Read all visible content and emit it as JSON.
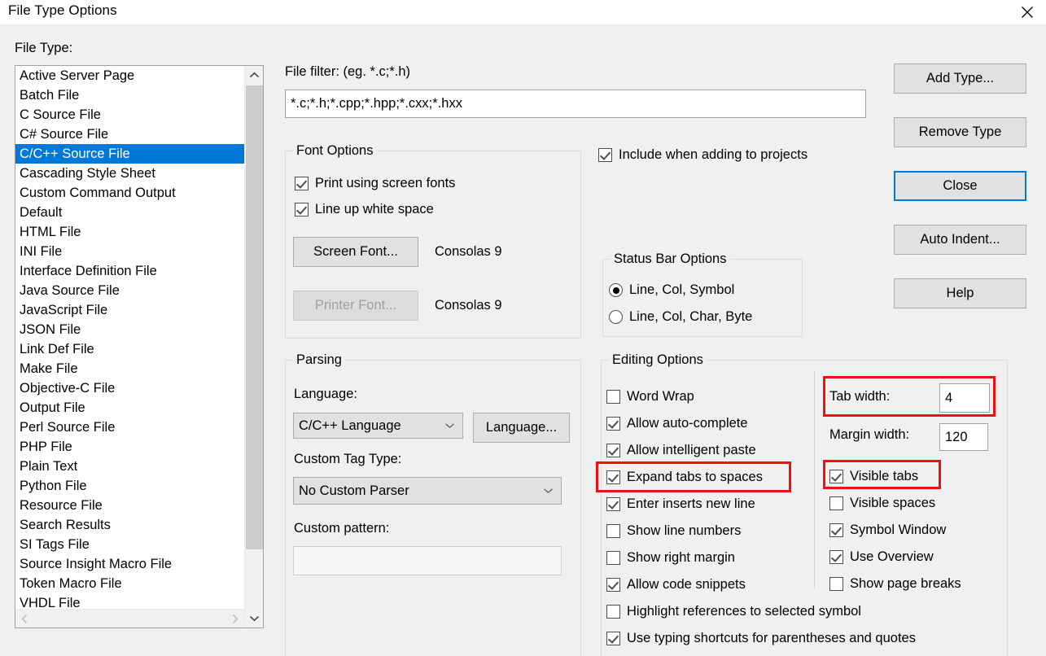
{
  "window": {
    "title": "File Type Options",
    "close_icon": "close-icon"
  },
  "file_type": {
    "label": "File Type:",
    "items": [
      "Active Server Page",
      "Batch File",
      "C Source File",
      "C# Source File",
      "C/C++ Source File",
      "Cascading Style Sheet",
      "Custom Command Output",
      "Default",
      "HTML File",
      "INI File",
      "Interface Definition File",
      "Java Source File",
      "JavaScript File",
      "JSON File",
      "Link Def File",
      "Make File",
      "Objective-C File",
      "Output File",
      "Perl Source File",
      "PHP File",
      "Plain Text",
      "Python File",
      "Resource File",
      "Search Results",
      "SI Tags File",
      "Source Insight Macro File",
      "Token Macro File",
      "VHDL File"
    ],
    "selected": "C/C++ Source File",
    "selected_index": 4,
    "selection_color": "#0078d7"
  },
  "file_filter": {
    "label": "File filter: (eg. *.c;*.h)",
    "value": "*.c;*.h;*.cpp;*.hpp;*.cxx;*.hxx"
  },
  "font_options": {
    "title": "Font Options",
    "print_using_screen_fonts": {
      "label": "Print using screen fonts",
      "checked": true
    },
    "line_up_white_space": {
      "label": "Line up white space",
      "checked": true
    },
    "screen_font_button": "Screen Font...",
    "screen_font_value": "Consolas 9",
    "printer_font_button": "Printer Font...",
    "printer_font_value": "Consolas 9",
    "printer_font_disabled": true
  },
  "include_when_adding": {
    "label": "Include when adding to projects",
    "checked": true
  },
  "status_bar_options": {
    "title": "Status Bar Options",
    "options": [
      {
        "label": "Line, Col, Symbol",
        "selected": true
      },
      {
        "label": "Line, Col, Char, Byte",
        "selected": false
      }
    ]
  },
  "parsing": {
    "title": "Parsing",
    "language_label": "Language:",
    "language_value": "C/C++ Language",
    "language_button": "Language...",
    "custom_tag_type_label": "Custom Tag Type:",
    "custom_tag_type_value": "No Custom Parser",
    "custom_pattern_label": "Custom pattern:",
    "custom_pattern_value": ""
  },
  "editing_options": {
    "title": "Editing Options",
    "left_column": [
      {
        "label": "Word Wrap",
        "checked": false
      },
      {
        "label": "Allow auto-complete",
        "checked": true
      },
      {
        "label": "Allow intelligent paste",
        "checked": true
      },
      {
        "label": "Expand tabs to spaces",
        "checked": true,
        "highlighted": true
      },
      {
        "label": "Enter inserts new line",
        "checked": true
      },
      {
        "label": "Show line numbers",
        "checked": false
      },
      {
        "label": "Show right margin",
        "checked": false
      },
      {
        "label": "Allow code snippets",
        "checked": true
      }
    ],
    "full_width_rows": [
      {
        "label": "Highlight references to selected symbol",
        "checked": false
      },
      {
        "label": "Use typing shortcuts for parentheses and quotes",
        "checked": true
      }
    ],
    "tab_width": {
      "label": "Tab width:",
      "value": "4",
      "highlighted": true
    },
    "margin_width": {
      "label": "Margin width:",
      "value": "120"
    },
    "right_column": [
      {
        "label": "Visible tabs",
        "checked": true,
        "highlighted": true
      },
      {
        "label": "Visible spaces",
        "checked": false
      },
      {
        "label": "Symbol Window",
        "checked": true
      },
      {
        "label": "Use Overview",
        "checked": true
      },
      {
        "label": "Show page breaks",
        "checked": false
      }
    ]
  },
  "buttons": {
    "add_type": "Add Type...",
    "remove_type": "Remove Type",
    "close": "Close",
    "auto_indent": "Auto Indent...",
    "help": "Help",
    "default_button": "Close"
  },
  "annotation": {
    "highlight_color": "#ee1111",
    "boxes": [
      "tab-width",
      "expand-tabs-to-spaces",
      "visible-tabs"
    ]
  }
}
